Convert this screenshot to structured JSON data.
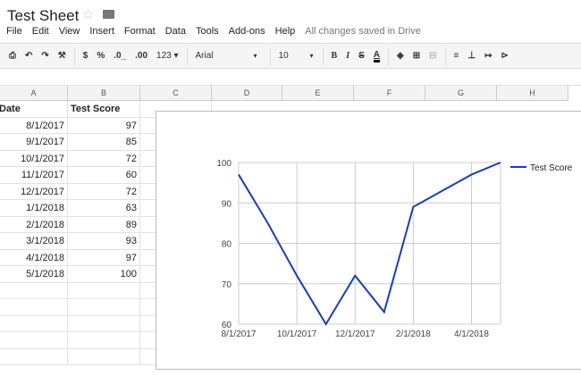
{
  "title": "Test Sheet",
  "menu": [
    "File",
    "Edit",
    "View",
    "Insert",
    "Format",
    "Data",
    "Tools",
    "Add-ons",
    "Help"
  ],
  "saved_status": "All changes saved in Drive",
  "toolbar": {
    "currency": "$",
    "percent": "%",
    "dec_less": ".0_",
    "dec_more": ".00",
    "format": "123 ▾",
    "font": "Arial",
    "font_size": "10",
    "bold": "B",
    "italic": "I",
    "strike": "S",
    "text_color": "A"
  },
  "columns": [
    "A",
    "B",
    "C",
    "D",
    "E",
    "F",
    "G",
    "H"
  ],
  "headers": [
    "Date",
    "Test Score"
  ],
  "rows": [
    [
      "8/1/2017",
      "97"
    ],
    [
      "9/1/2017",
      "85"
    ],
    [
      "10/1/2017",
      "72"
    ],
    [
      "11/1/2017",
      "60"
    ],
    [
      "12/1/2017",
      "72"
    ],
    [
      "1/1/2018",
      "63"
    ],
    [
      "2/1/2018",
      "89"
    ],
    [
      "3/1/2018",
      "93"
    ],
    [
      "4/1/2018",
      "97"
    ],
    [
      "5/1/2018",
      "100"
    ]
  ],
  "chart_data": {
    "type": "line",
    "x": [
      "8/1/2017",
      "9/1/2017",
      "10/1/2017",
      "11/1/2017",
      "12/1/2017",
      "1/1/2018",
      "2/1/2018",
      "3/1/2018",
      "4/1/2018",
      "5/1/2018"
    ],
    "series": [
      {
        "name": "Test Score",
        "values": [
          97,
          85,
          72,
          60,
          72,
          63,
          89,
          93,
          97,
          100
        ],
        "color": "#1a3fb0"
      }
    ],
    "xticks": [
      "8/1/2017",
      "10/1/2017",
      "12/1/2017",
      "2/1/2018",
      "4/1/2018"
    ],
    "yticks": [
      60,
      70,
      80,
      90,
      100
    ],
    "ylim": [
      60,
      100
    ],
    "legend": "right"
  }
}
